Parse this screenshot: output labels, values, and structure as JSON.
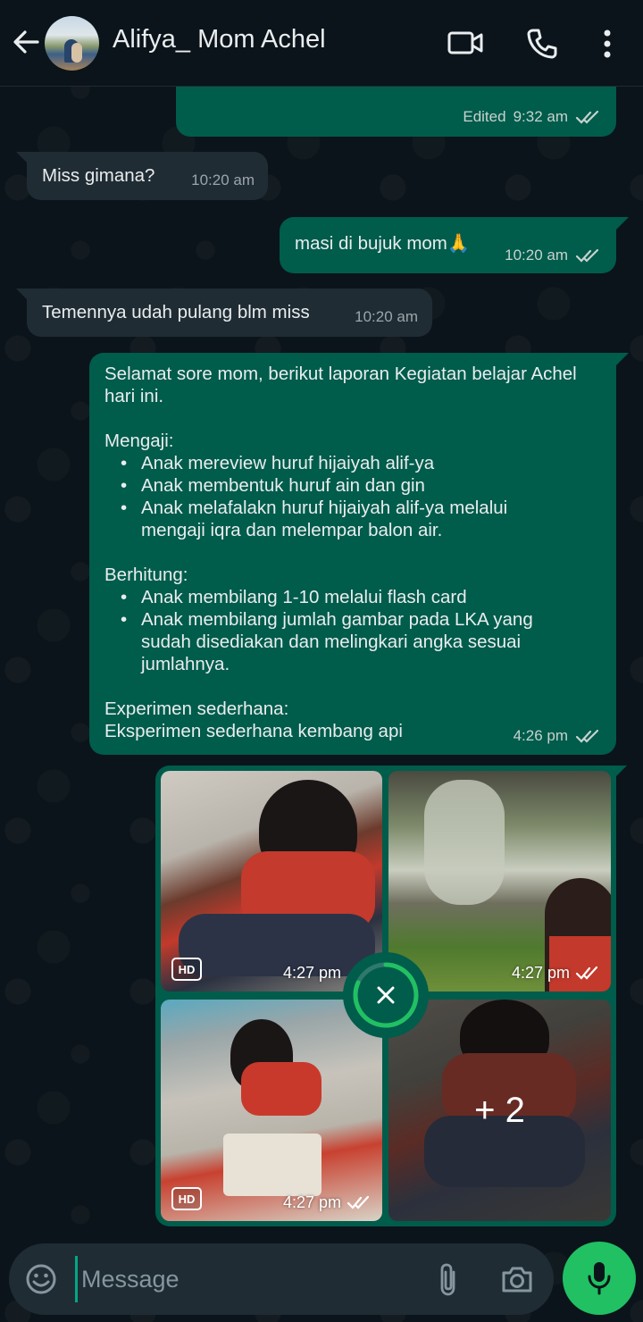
{
  "header": {
    "contact_name": "Alifya_ Mom Achel"
  },
  "messages": {
    "m0": {
      "partial_text": "",
      "edited_label": "Edited",
      "time": "9:32 am"
    },
    "m1": {
      "text": "Miss gimana?",
      "time": "10:20 am"
    },
    "m2": {
      "text": "masi di bujuk mom🙏",
      "time": "10:20 am"
    },
    "m3": {
      "text": "Temennya udah pulang blm miss",
      "time": "10:20 am"
    },
    "m4": {
      "intro": "Selamat sore mom,  berikut laporan Kegiatan belajar Achel hari ini.",
      "section1_title": "Mengaji:",
      "section1_items": [
        "Anak mereview huruf hijaiyah alif-ya",
        "Anak membentuk huruf ain dan gin",
        "Anak melafalakn huruf hijaiyah alif-ya melalui mengaji iqra dan melempar balon air."
      ],
      "section2_title": "Berhitung:",
      "section2_items": [
        "Anak membilang 1-10 melalui flash card",
        "Anak membilang jumlah gambar pada LKA yang sudah disediakan dan melingkari angka sesuai jumlahnya."
      ],
      "section3_title": "Experimen sederhana:",
      "section3_text": "Eksperimen sederhana kembang api",
      "time": "4:26 pm"
    },
    "photos": {
      "hd_label": "HD",
      "p1_time": "4:27 pm",
      "p2_time": "4:27 pm",
      "p3_time": "4:27 pm",
      "more_count": "+ 2"
    }
  },
  "composer": {
    "placeholder": "Message"
  },
  "colors": {
    "bg": "#0b141a",
    "incoming_bubble": "#202c33",
    "outgoing_bubble": "#005c4b",
    "accent": "#21c063"
  },
  "icons": [
    "back-arrow-icon",
    "video-call-icon",
    "phone-call-icon",
    "more-options-icon",
    "double-check-icon",
    "hd-badge",
    "close-icon",
    "emoji-icon",
    "attach-icon",
    "camera-icon",
    "mic-icon"
  ]
}
